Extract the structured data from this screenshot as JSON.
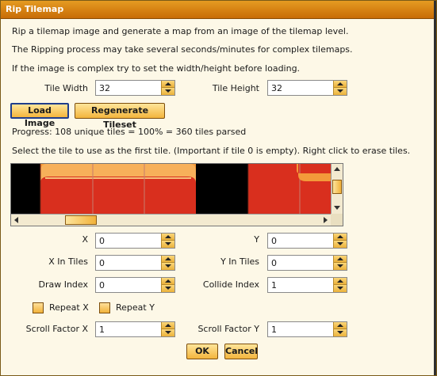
{
  "window": {
    "title": "Rip Tilemap"
  },
  "intro": {
    "line1": "Rip a tilemap image and generate a map from an image of the tilemap level.",
    "line2": "The Ripping process may take several seconds/minutes for complex tilemaps.",
    "line3": "If the image is complex try to set the width/height before loading."
  },
  "tile_width": {
    "label": "Tile Width",
    "value": "32"
  },
  "tile_height": {
    "label": "Tile Height",
    "value": "32"
  },
  "buttons": {
    "load_image": "Load Image",
    "regenerate_tileset": "Regenerate Tileset",
    "ok": "OK",
    "cancel": "Cancel"
  },
  "progress_text": "Progress: 108 unique tiles = 100% = 360 tiles parsed",
  "select_text": "Select the tile to use as the first tile. (Important if tile 0 is empty). Right click to erase tiles.",
  "fields": {
    "x": {
      "label": "X",
      "value": "0"
    },
    "y": {
      "label": "Y",
      "value": "0"
    },
    "x_in_tiles": {
      "label": "X In Tiles",
      "value": "0"
    },
    "y_in_tiles": {
      "label": "Y In Tiles",
      "value": "0"
    },
    "draw_index": {
      "label": "Draw Index",
      "value": "0"
    },
    "collide_index": {
      "label": "Collide Index",
      "value": "1"
    },
    "scroll_factor_x": {
      "label": "Scroll Factor X",
      "value": "1"
    },
    "scroll_factor_y": {
      "label": "Scroll Factor Y",
      "value": "1"
    }
  },
  "checkboxes": {
    "repeat_x": {
      "label": "Repeat X",
      "checked": false
    },
    "repeat_y": {
      "label": "Repeat Y",
      "checked": false
    }
  },
  "colors": {
    "title_bar": "#d57d0f",
    "button_fill": "#f3b53d",
    "tile_red": "#d92f1e",
    "tile_orange": "#f39a3a"
  }
}
